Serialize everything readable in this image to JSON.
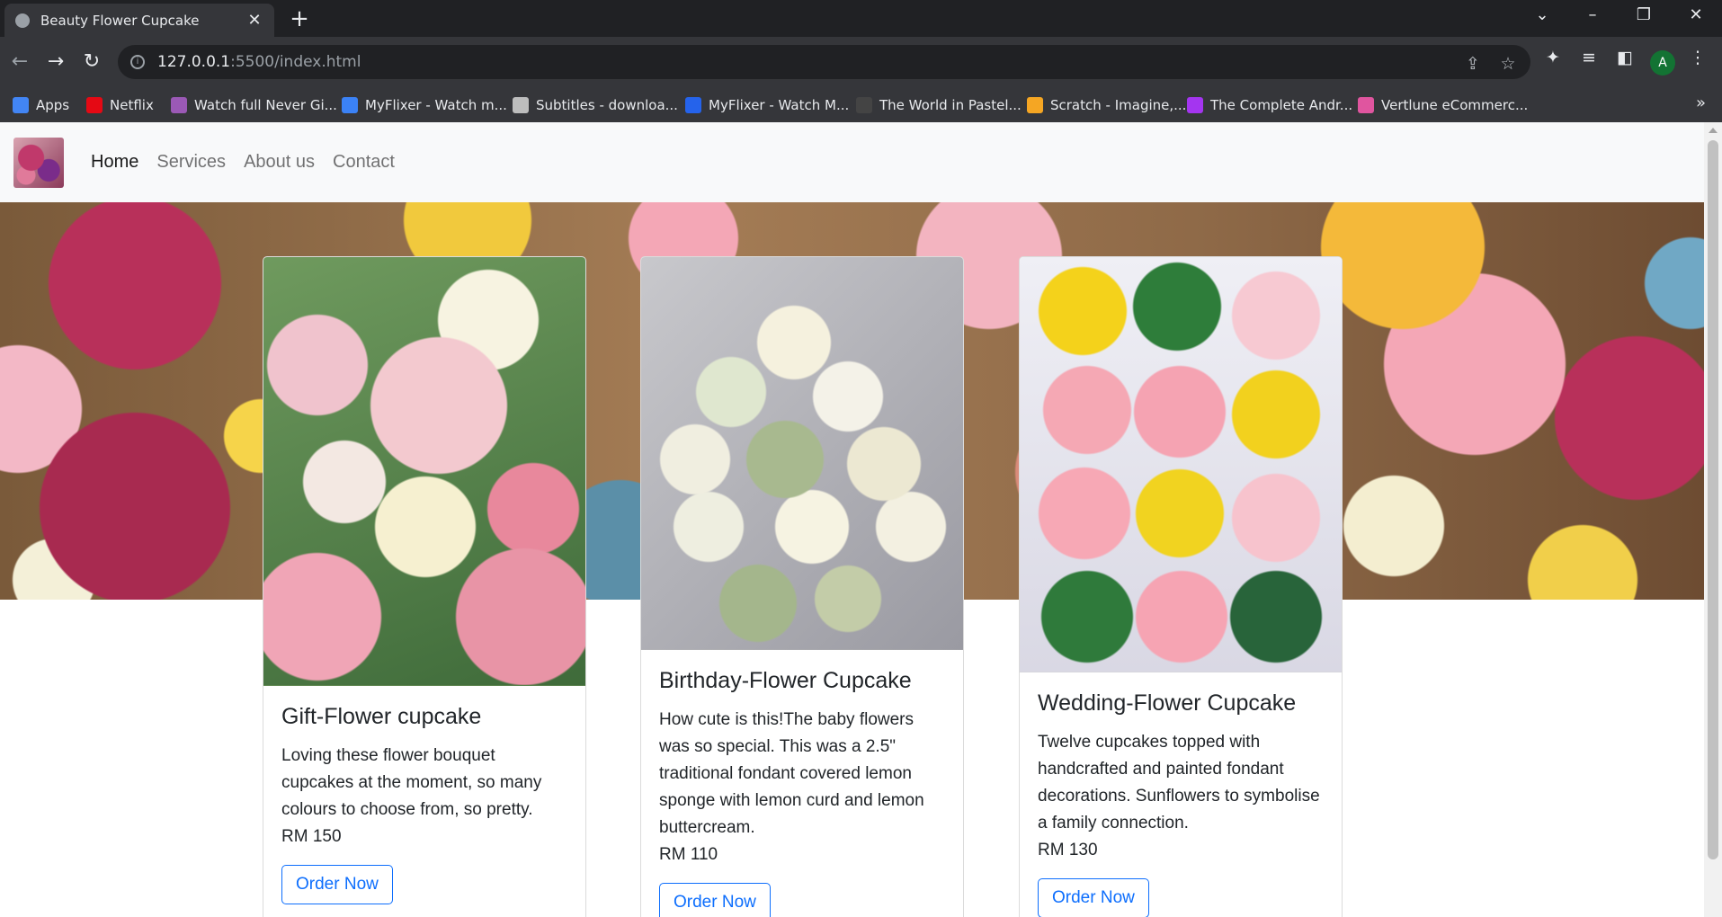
{
  "browser": {
    "tab_title": "Beauty Flower Cupcake",
    "url_host": "127.0.0.1",
    "url_rest": ":5500/index.html",
    "profile_initial": "A",
    "bookmarks": [
      {
        "label": "Apps",
        "color": "#4285f4"
      },
      {
        "label": "Netflix",
        "color": "#e50914"
      },
      {
        "label": "Watch full Never Gi...",
        "color": "#9b59b6"
      },
      {
        "label": "MyFlixer - Watch m...",
        "color": "#3b82f6"
      },
      {
        "label": "Subtitles - downloa...",
        "color": "#bdbdbd"
      },
      {
        "label": "MyFlixer - Watch M...",
        "color": "#2563eb"
      },
      {
        "label": "The World in Pastel...",
        "color": "#444444"
      },
      {
        "label": "Scratch - Imagine,...",
        "color": "#f5a623"
      },
      {
        "label": "The Complete Andr...",
        "color": "#a435f0"
      },
      {
        "label": "Vertlune eCommerc...",
        "color": "#e0559f"
      }
    ]
  },
  "nav": {
    "links": [
      "Home",
      "Services",
      "About us",
      "Contact"
    ],
    "active": "Home"
  },
  "cards": [
    {
      "title": "Gift-Flower cupcake",
      "text": "Loving these flower bouquet cupcakes at the moment, so many colours to choose from, so pretty.",
      "price": "RM 150",
      "button": "Order Now"
    },
    {
      "title": "Birthday-Flower Cupcake",
      "text": "How cute is this!The baby flowers was so special. This was a 2.5\" traditional fondant covered lemon sponge with lemon curd and lemon buttercream.",
      "price": "RM 110",
      "button": "Order Now"
    },
    {
      "title": "Wedding-Flower Cupcake",
      "text": "Twelve cupcakes topped with handcrafted and painted fondant decorations. Sunflowers to symbolise a family connection.",
      "price": "RM 130",
      "button": "Order Now"
    }
  ],
  "colors": {
    "accent": "#0d6efd",
    "navbar_bg": "#f8f9fa"
  }
}
